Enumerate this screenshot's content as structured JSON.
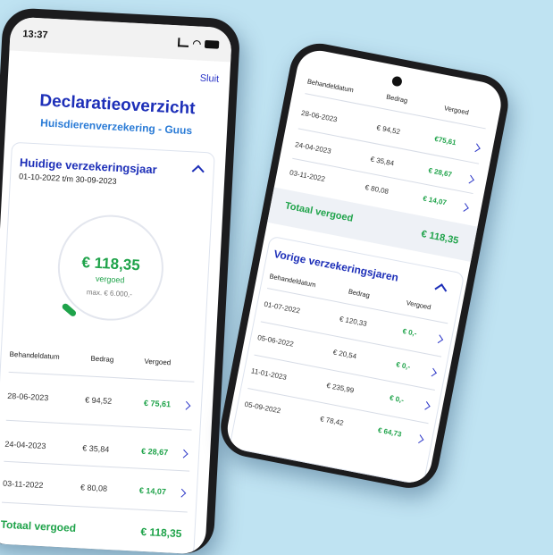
{
  "left_phone": {
    "status_time": "13:37",
    "close_label": "Sluit",
    "title": "Declaratieoverzicht",
    "subtitle": "Huisdierenverzekering - Guus",
    "current_year": {
      "heading": "Huidige verzekeringsjaar",
      "period": "01-10-2022 t/m 30-09-2023",
      "reimbursed_amount": "€ 118,35",
      "reimbursed_label": "vergoed",
      "max_label": "max. € 6.000,-",
      "progress_fraction": 0.02
    },
    "table": {
      "headers": [
        "Behandeldatum",
        "Bedrag",
        "Vergoed"
      ],
      "rows": [
        {
          "date": "28-06-2023",
          "amount": "€ 94,52",
          "reimbursed": "€ 75,61"
        },
        {
          "date": "24-04-2023",
          "amount": "€ 35,84",
          "reimbursed": "€ 28,67"
        },
        {
          "date": "03-11-2022",
          "amount": "€ 80,08",
          "reimbursed": "€ 14,07"
        }
      ]
    },
    "total_label": "Totaal vergoed",
    "total_value": "€ 118,35"
  },
  "right_phone": {
    "table": {
      "headers": [
        "Behandeldatum",
        "Bedrag",
        "Vergoed"
      ],
      "rows": [
        {
          "date": "28-06-2023",
          "amount": "€ 94,52",
          "reimbursed": "€75,61"
        },
        {
          "date": "24-04-2023",
          "amount": "€ 35,84",
          "reimbursed": "€ 28,67"
        },
        {
          "date": "03-11-2022",
          "amount": "€ 80,08",
          "reimbursed": "€ 14,07"
        }
      ]
    },
    "total_label": "Totaal vergoed",
    "total_value": "€ 118,35",
    "previous_years": {
      "heading": "Vorige verzekeringsjaren",
      "headers": [
        "Behandeldatum",
        "Bedrag",
        "Vergoed"
      ],
      "rows": [
        {
          "date": "01-07-2022",
          "amount": "€ 120,33",
          "reimbursed": "€ 0,-"
        },
        {
          "date": "05-06-2022",
          "amount": "€ 20,54",
          "reimbursed": "€ 0,-"
        },
        {
          "date": "11-01-2023",
          "amount": "€ 235,99",
          "reimbursed": "€ 0,-"
        },
        {
          "date": "05-09-2022",
          "amount": "€ 78,42",
          "reimbursed": "€ 64,73"
        }
      ]
    }
  },
  "colors": {
    "background": "#bfe3f2",
    "brand_blue": "#1d2fb8",
    "green": "#1fa34a"
  }
}
